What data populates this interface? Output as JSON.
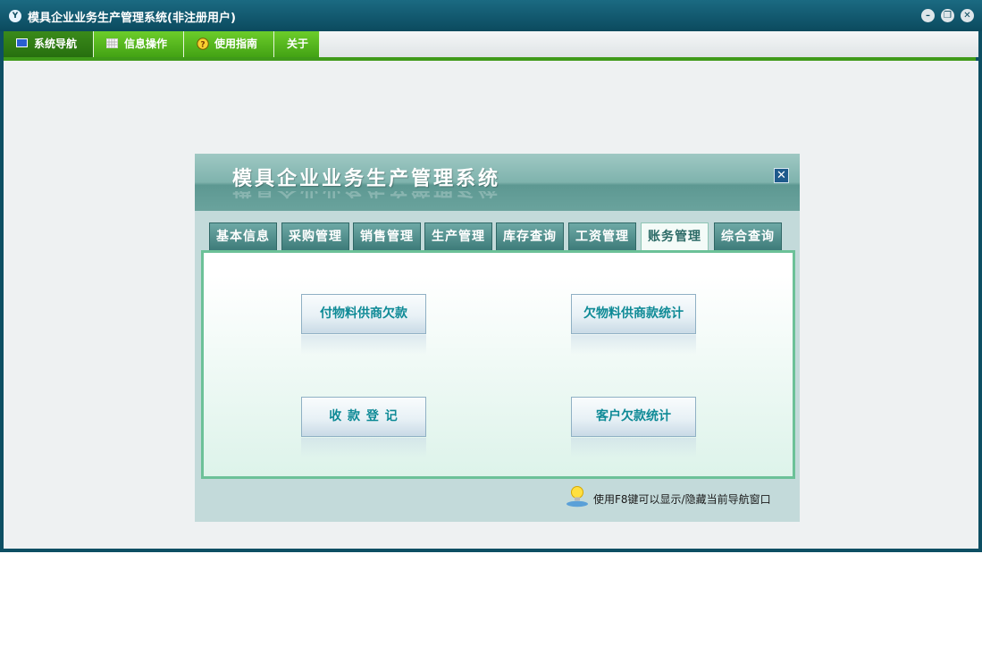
{
  "window": {
    "title": "模具企业业务生产管理系统(非注册用户)"
  },
  "menubar": {
    "tabs": [
      {
        "label": "系统导航",
        "icon": "monitor-icon"
      },
      {
        "label": "信息操作",
        "icon": "grid-icon"
      },
      {
        "label": "使用指南",
        "icon": "help-icon"
      },
      {
        "label": "关于",
        "icon": ""
      }
    ]
  },
  "dialog": {
    "title": "模具企业业务生产管理系统",
    "tabs": [
      {
        "label": "基本信息"
      },
      {
        "label": "采购管理"
      },
      {
        "label": "销售管理"
      },
      {
        "label": "生产管理"
      },
      {
        "label": "库存查询"
      },
      {
        "label": "工资管理"
      },
      {
        "label": "账务管理"
      },
      {
        "label": "综合查询"
      }
    ],
    "active_tab": "账务管理",
    "buttons": [
      {
        "label": "付物料供商欠款"
      },
      {
        "label": "欠物料供商款统计"
      },
      {
        "label": "收 款 登 记"
      },
      {
        "label": "客户欠款统计"
      }
    ],
    "hint": "使用F8键可以显示/隐藏当前导航窗口"
  },
  "colors": {
    "frame": "#0d4f63",
    "menu_green": "#5cbf22",
    "menu_active": "#2f7e14",
    "dialog_header": "#7fb3ad",
    "tab_teal": "#3d7b79",
    "panel_border": "#6cc198",
    "button_text": "#0e8a96"
  }
}
